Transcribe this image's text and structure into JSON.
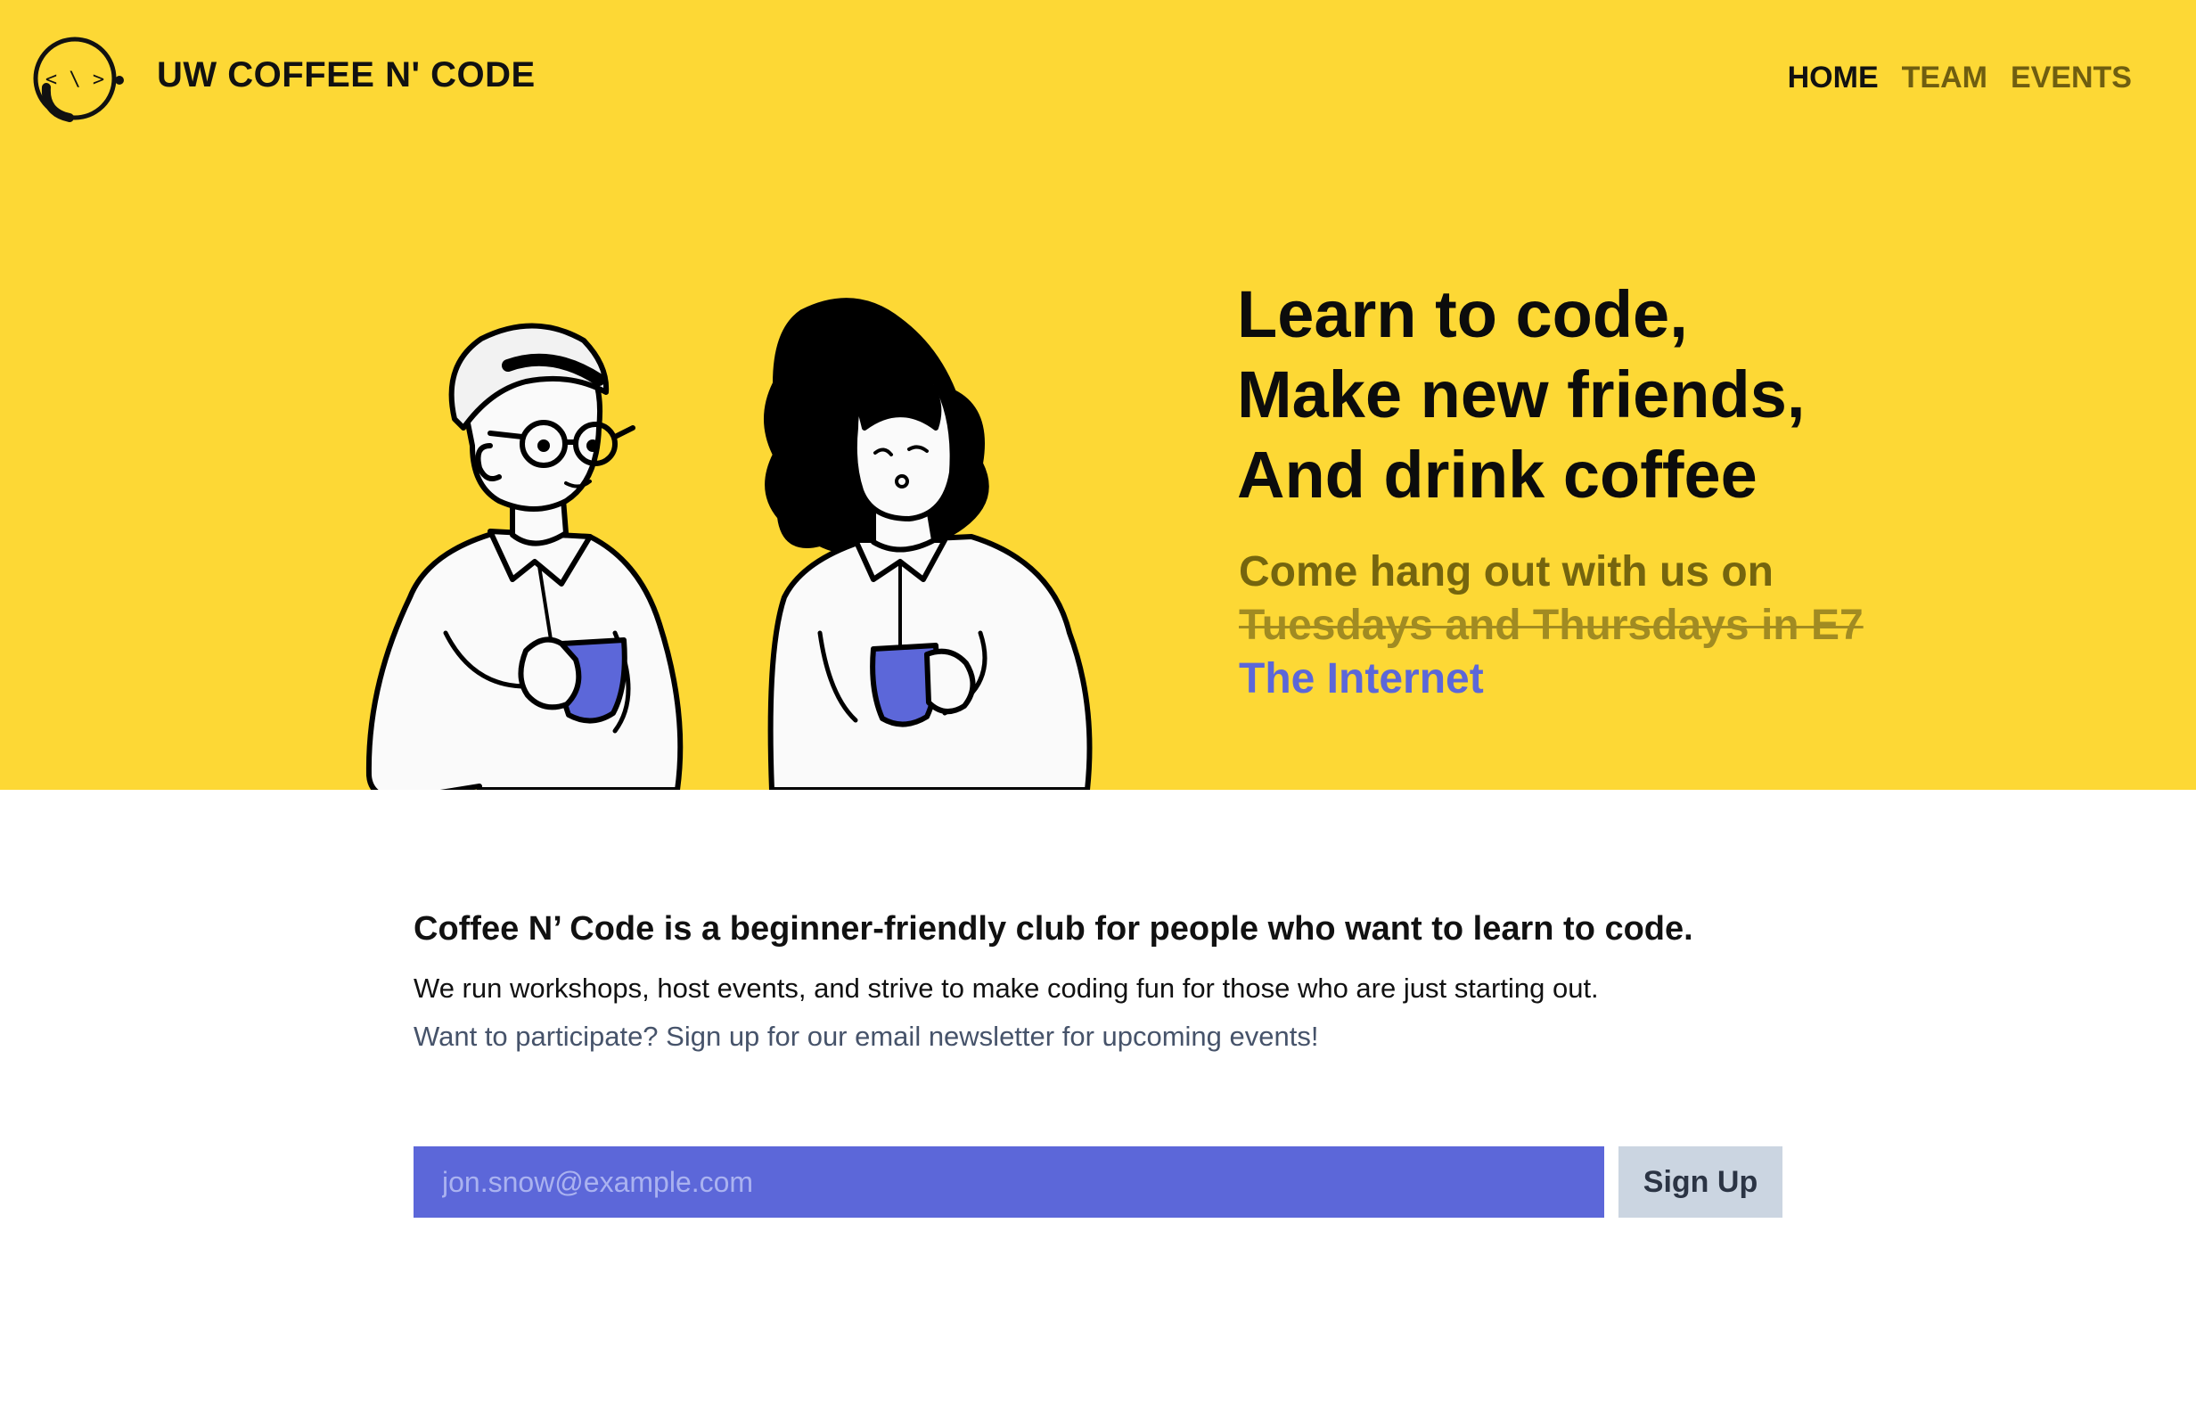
{
  "header": {
    "brand": "UW COFFEE N' CODE",
    "logo_text": "< \\ >",
    "nav": [
      {
        "label": "HOME",
        "active": true
      },
      {
        "label": "TEAM",
        "active": false
      },
      {
        "label": "EVENTS",
        "active": false
      }
    ]
  },
  "hero": {
    "headline": [
      "Learn to code,",
      "Make new friends,",
      "And drink coffee"
    ],
    "subhead": "Come hang out with us on",
    "old_location": "Tuesdays and Thursdays in E7",
    "new_location": "The Internet",
    "illustration": "two-people-drinking-coffee"
  },
  "about": {
    "lead": "Coffee N’ Code is a beginner-friendly club for people who want to learn to code.",
    "description": "We run workshops, host events, and strive to make coding fun for those who are just starting out.",
    "cta": "Want to participate? Sign up for our email newsletter for upcoming events!"
  },
  "signup": {
    "placeholder": "jon.snow@example.com",
    "button_label": "Sign Up"
  },
  "colors": {
    "hero_bg": "#fdd835",
    "accent": "#5c67d9",
    "button_bg": "#cbd5e1"
  }
}
